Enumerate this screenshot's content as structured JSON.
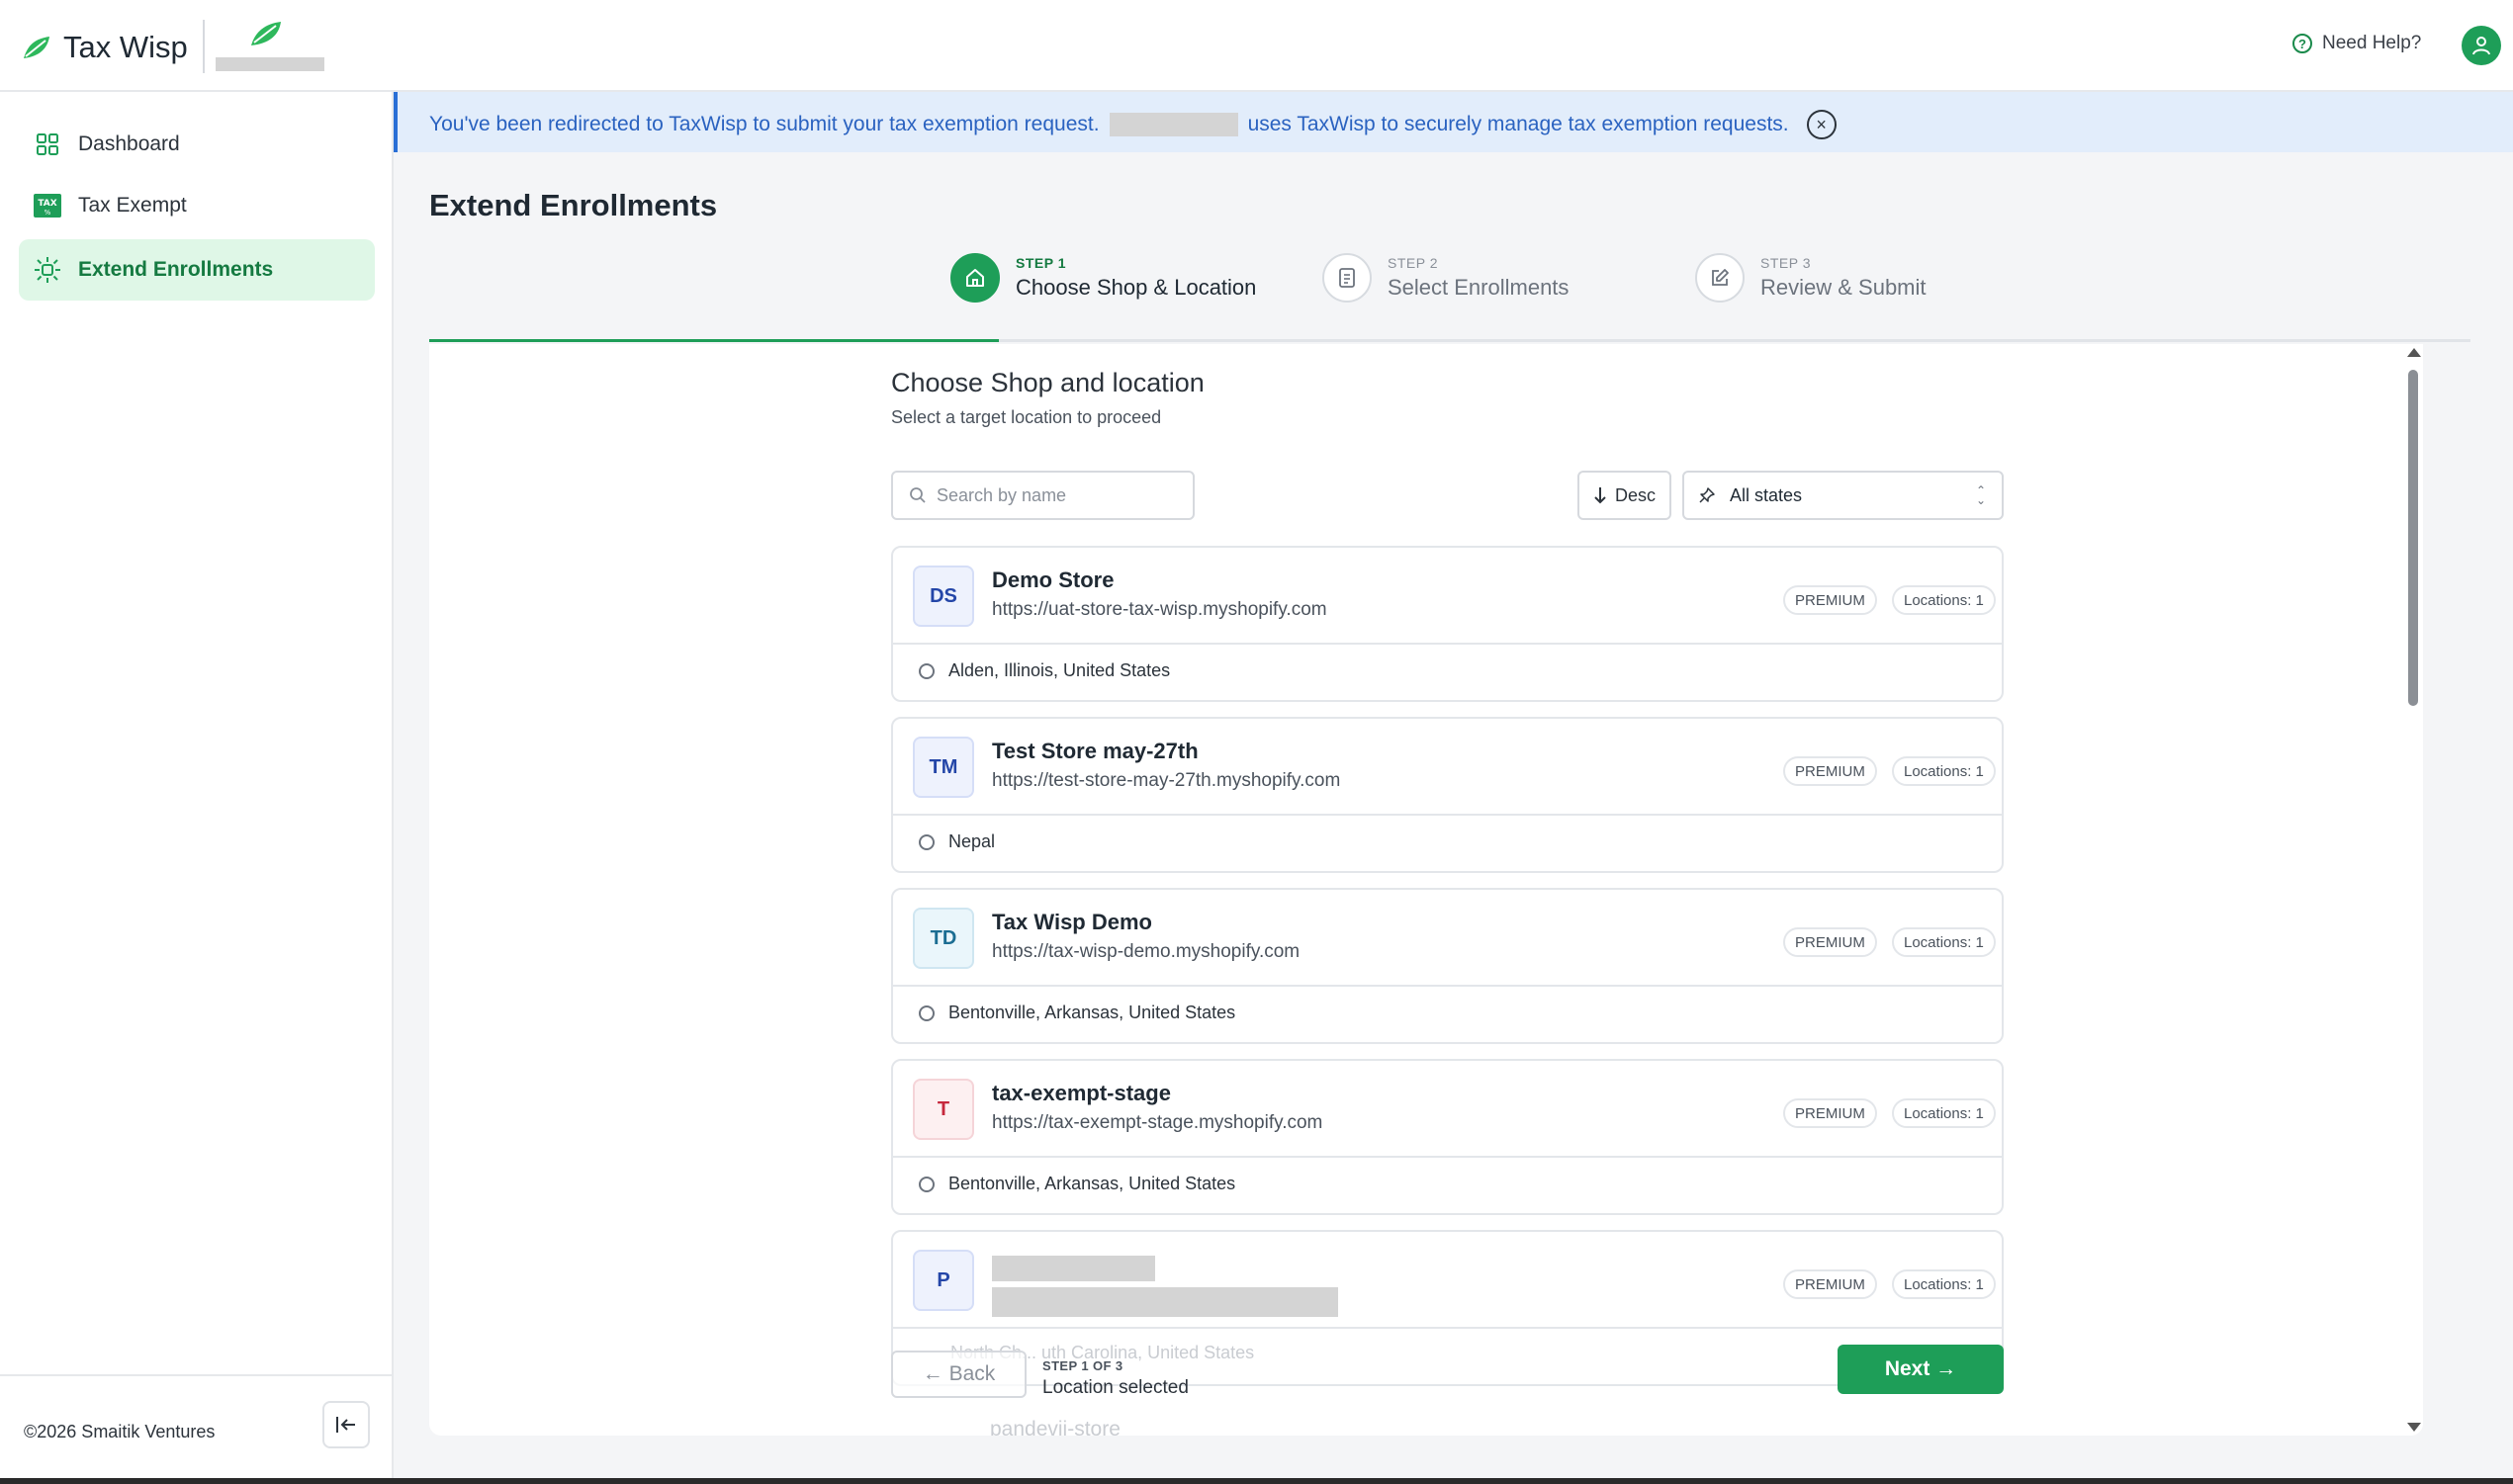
{
  "brand": {
    "name": "Tax Wisp"
  },
  "header": {
    "help_label": "Need Help?"
  },
  "sidebar": {
    "items": [
      {
        "label": "Dashboard",
        "icon": "grid-icon",
        "active": false
      },
      {
        "label": "Tax Exempt",
        "icon": "tax-icon",
        "active": false
      },
      {
        "label": "Extend Enrollments",
        "icon": "sparkle-icon",
        "active": true
      }
    ],
    "copyright": "©2026 Smaitik Ventures"
  },
  "banner": {
    "text_before": "You've been redirected to TaxWisp to submit your tax exemption request.",
    "text_after": "uses TaxWisp to securely manage tax exemption requests."
  },
  "page": {
    "title": "Extend Enrollments"
  },
  "steps": [
    {
      "small": "STEP 1",
      "label": "Choose Shop & Location",
      "active": true
    },
    {
      "small": "STEP 2",
      "label": "Select Enrollments",
      "active": false
    },
    {
      "small": "STEP 3",
      "label": "Review & Submit",
      "active": false
    }
  ],
  "section": {
    "title": "Choose Shop and location",
    "subtitle": "Select a target location to proceed"
  },
  "filters": {
    "search_placeholder": "Search by name",
    "sort_label": "Desc",
    "state_label": "All states"
  },
  "stores": [
    {
      "initials": "DS",
      "name": "Demo Store",
      "url": "https://uat-store-tax-wisp.myshopify.com",
      "plan": "PREMIUM",
      "locations": "Locations: 1",
      "location": "Alden, Illinois, United States"
    },
    {
      "initials": "TM",
      "name": "Test Store may-27th",
      "url": "https://test-store-may-27th.myshopify.com",
      "plan": "PREMIUM",
      "locations": "Locations: 1",
      "location": "Nepal"
    },
    {
      "initials": "TD",
      "name": "Tax Wisp Demo",
      "url": "https://tax-wisp-demo.myshopify.com",
      "plan": "PREMIUM",
      "locations": "Locations: 1",
      "location": "Bentonville, Arkansas, United States"
    },
    {
      "initials": "T",
      "name": "tax-exempt-stage",
      "url": "https://tax-exempt-stage.myshopify.com",
      "plan": "PREMIUM",
      "locations": "Locations: 1",
      "location": "Bentonville, Arkansas, United States"
    },
    {
      "initials": "P",
      "plan": "PREMIUM",
      "locations": "Locations: 1",
      "location": "North Ch... uth Carolina, United States"
    }
  ],
  "ghost_store_name": "pandevii-store",
  "footer": {
    "back_label": "← Back",
    "step_of": "STEP 1  OF 3",
    "status": "Location selected",
    "next_label": "Next →"
  }
}
